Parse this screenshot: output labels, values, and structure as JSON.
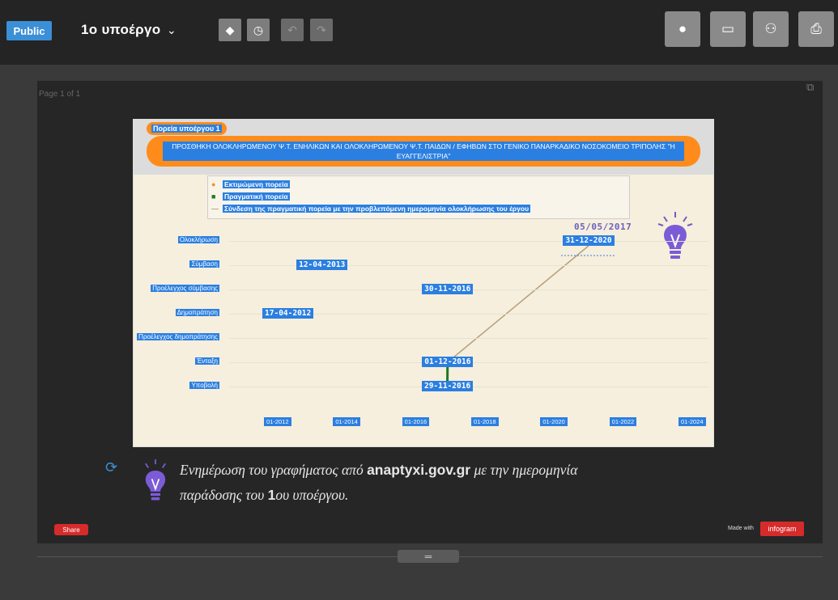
{
  "topbar": {
    "public_label": "Public",
    "project_title": "1ο υποέργο",
    "title_chevron": "⌄",
    "tool_tag": "◆",
    "tool_history": "◷",
    "tool_undo": "↶",
    "tool_redo": "↷",
    "right_comment": "●",
    "right_present": "▭",
    "right_share": "⚇",
    "right_download": "⎙"
  },
  "editor": {
    "page_label": "Page 1 of 1",
    "copy_icon": "⧉"
  },
  "slide": {
    "tag": "Πορεία υποέργου 1",
    "banner": "ΠΡΟΣΘΗΚΗ ΟΛΟΚΛΗΡΩΜΕΝΟΥ Ψ.Τ. ΕΝΗΛΙΚΩΝ ΚΑΙ ΟΛΟΚΛΗΡΩΜΕΝΟΥ Ψ.Τ. ΠΑΙΔΩΝ / ΕΦΗΒΩΝ ΣΤΟ ΓΕΝΙΚΟ ΠΑΝΑΡΚΑΔΙΚΟ ΝΟΣΟΚΟΜΕΙΟ ΤΡΙΠΟΛΗΣ \"Η ΕΥΑΓΓΕΛΙΣΤΡΙΑ\"",
    "legend": [
      {
        "marker": "●",
        "color": "#ff8c1a",
        "label": "Εκτιμώμενη πορεία"
      },
      {
        "marker": "■",
        "color": "#1f7a1f",
        "label": "Πραγματική πορεία"
      },
      {
        "marker": "—",
        "color": "#b8a07a",
        "label": "Σύνδεση της πραγματική πορεία με την προβλεπόμενη ημερομηνία ολοκλήρωσης του έργου"
      }
    ],
    "annotation_date": "05/05/2017",
    "caption_prefix": "Ενημέρωση του γραφήματος από",
    "caption_site": "anaptyxi.gov.gr",
    "caption_mid": "με την ημερομηνία παράδοσης του",
    "caption_num": "1",
    "caption_suffix": "ου υποέργου.",
    "share_label": "Share",
    "made_with": "Made with",
    "infogram": "infogram"
  },
  "chart_data": {
    "type": "scatter",
    "title": "Πορεία υποέργου 1",
    "categories": [
      "Ολοκλήρωση",
      "Σύμβαση",
      "Προέλεγχος σύμβασης",
      "Δημοπράτηση",
      "Προέλεγχος δημοπράτησης",
      "Ένταξη",
      "Υποβολή"
    ],
    "x_ticks": [
      "01-2012",
      "01-2014",
      "01-2016",
      "01-2018",
      "01-2020",
      "01-2022",
      "01-2024"
    ],
    "xlim": [
      "2012-01",
      "2024-01"
    ],
    "points": [
      {
        "category": "Ολοκλήρωση",
        "date": "31-12-2020"
      },
      {
        "category": "Σύμβαση",
        "date": "12-04-2013"
      },
      {
        "category": "Προέλεγχος σύμβασης",
        "date": "30-11-2016"
      },
      {
        "category": "Δημοπράτηση",
        "date": "17-04-2012"
      },
      {
        "category": "Ένταξη",
        "date": "01-12-2016"
      },
      {
        "category": "Υποβολή",
        "date": "29-11-2016"
      }
    ],
    "grid": true,
    "legend_position": "top"
  }
}
